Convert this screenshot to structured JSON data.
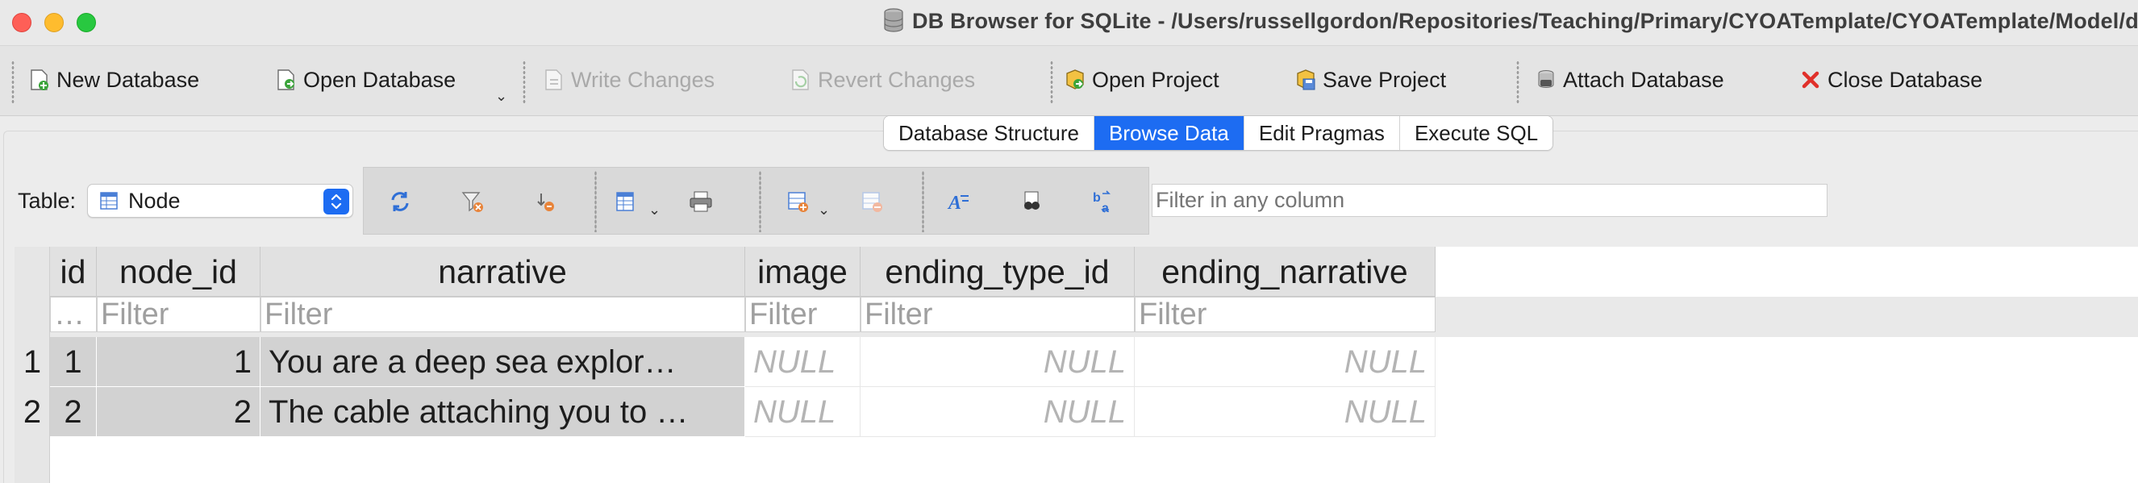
{
  "window": {
    "title": "DB Browser for SQLite - /Users/russellgordon/Repositories/Teaching/Primary/CYOATemplate/CYOATemplate/Model/db",
    "icon": "database-icon"
  },
  "toolbar": {
    "new_database": "New Database",
    "open_database": "Open Database",
    "write_changes": "Write Changes",
    "revert_changes": "Revert Changes",
    "open_project": "Open Project",
    "save_project": "Save Project",
    "attach_database": "Attach Database",
    "close_database": "Close Database"
  },
  "tabs": [
    {
      "label": "Database Structure",
      "active": false
    },
    {
      "label": "Browse Data",
      "active": true
    },
    {
      "label": "Edit Pragmas",
      "active": false
    },
    {
      "label": "Execute SQL",
      "active": false
    }
  ],
  "browse": {
    "table_label": "Table:",
    "table_selected": "Node",
    "filter_placeholder": "Filter in any column"
  },
  "grid": {
    "columns": [
      "id",
      "node_id",
      "narrative",
      "image",
      "ending_type_id",
      "ending_narrative"
    ],
    "filter_placeholder": "Filter",
    "id_filter_placeholder": "…",
    "rows": [
      {
        "num": "1",
        "id": "1",
        "node_id": "1",
        "narrative": "You are a deep sea explor…",
        "image": "NULL",
        "ending_type_id": "NULL",
        "ending_narrative": "NULL"
      },
      {
        "num": "2",
        "id": "2",
        "node_id": "2",
        "narrative": "The cable attaching you to …",
        "image": "NULL",
        "ending_type_id": "NULL",
        "ending_narrative": "NULL"
      }
    ]
  },
  "colors": {
    "accent": "#1d6cf2",
    "close_red": "#fe5f57",
    "minimize_yellow": "#febc2e",
    "maximize_green": "#28c840"
  }
}
